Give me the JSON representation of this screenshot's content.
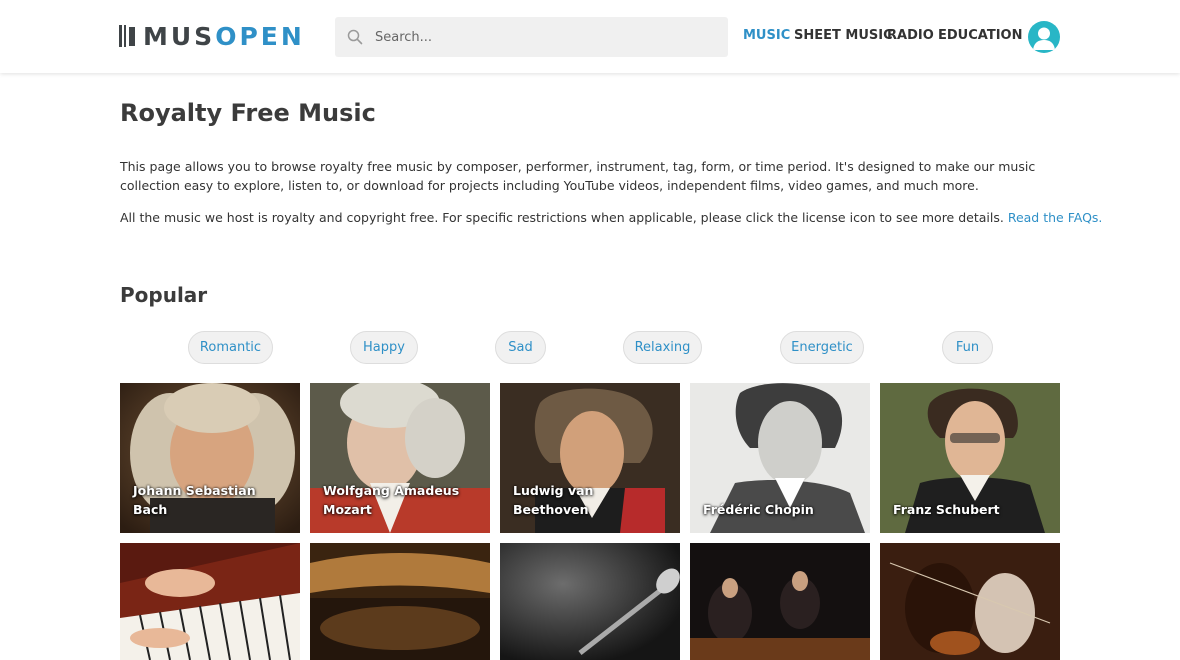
{
  "header": {
    "logo": {
      "part1": "MUS",
      "part2": "OPEN"
    },
    "search": {
      "placeholder": "Search..."
    },
    "nav": [
      {
        "label": "MUSIC",
        "active": true
      },
      {
        "label": "SHEET MUSIC",
        "active": false
      },
      {
        "label": "RADIO",
        "active": false
      },
      {
        "label": "EDUCATION",
        "active": false
      }
    ],
    "icons": {
      "search": "search-icon",
      "avatar": "user-avatar-icon"
    }
  },
  "main": {
    "title": "Royalty Free Music",
    "intro": "This page allows you to browse royalty free music by composer, performer, instrument, tag, form, or time period. It's designed to make our music collection easy to explore, listen to, or download for projects including YouTube videos, independent films, video games, and much more.",
    "intro2": "All the music we host is royalty and copyright free. For specific restrictions when applicable, please click the license icon to see more details.",
    "faq_link": "Read the FAQs.",
    "popular_title": "Popular",
    "tags": [
      "Romantic",
      "Happy",
      "Sad",
      "Relaxing",
      "Energetic",
      "Fun"
    ],
    "composers": [
      {
        "name": "Johann Sebastian Bach"
      },
      {
        "name": "Wolfgang Amadeus Mozart"
      },
      {
        "name": "Ludwig van Beethoven"
      },
      {
        "name": "Frédéric Chopin"
      },
      {
        "name": "Franz Schubert"
      }
    ]
  },
  "colors": {
    "accent": "#2f90c7",
    "logo_dark": "#3f4447",
    "avatar": "#28b6c6",
    "tag_bg": "#f1f1f1"
  }
}
